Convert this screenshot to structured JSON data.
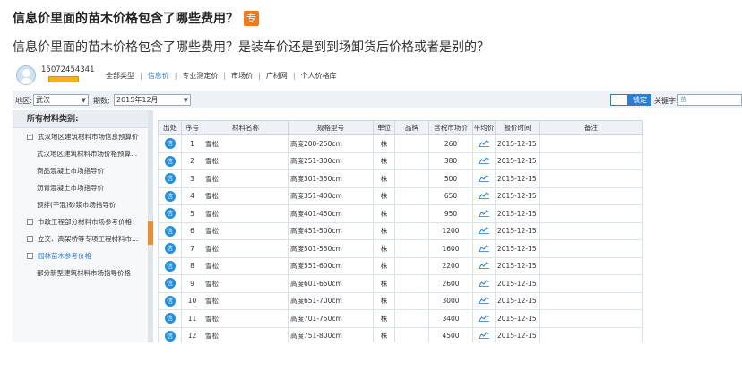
{
  "question": {
    "title": "信息价里面的苗木价格包含了哪些费用？",
    "badge": "专",
    "body": "信息价里面的苗木价格包含了哪些费用？是装车价还是到到场卸货后价格或者是别的？"
  },
  "app": {
    "user_id": "15072454341",
    "nav": [
      "全部类型",
      "信息价",
      "专业测定价",
      "市场价",
      "广材网",
      "个人价格库"
    ],
    "nav_active": "信息价",
    "filter": {
      "region_label": "地区:",
      "region_value": "武汉",
      "period_label": "期数:",
      "period_value": "2015年12月",
      "ok_label": "锁定",
      "keyword_label": "关键字:",
      "keyword_placeholder": "苗"
    },
    "sidebar": {
      "title": "所有材料类别:",
      "items": [
        {
          "label": "武汉地区建筑材料市场信息预算价",
          "has_toggle": true
        },
        {
          "label": "武汉地区建筑材料市场价格预算...",
          "has_toggle": false
        },
        {
          "label": "商品混凝土市场指导价",
          "has_toggle": false
        },
        {
          "label": "沥青混凝土市场指导价",
          "has_toggle": false
        },
        {
          "label": "预拌(干混)砂浆市场指导价",
          "has_toggle": false
        },
        {
          "label": "市政工程部分材料市场参考价格",
          "has_toggle": true
        },
        {
          "label": "立交、高架桥等专项工程材料市...",
          "has_toggle": true
        },
        {
          "label": "园林苗木参考价格",
          "has_toggle": true,
          "selected": true
        },
        {
          "label": "部分新型建筑材料市场指导价格",
          "has_toggle": false
        }
      ]
    },
    "table": {
      "headers": [
        "出处",
        "序号",
        "材料名称",
        "规格型号",
        "单位",
        "品牌",
        "含税市场价",
        "平均价",
        "报价时间",
        "备注"
      ],
      "source_badge": "信",
      "rows": [
        {
          "no": "1",
          "name": "雪松",
          "spec": "高度200-250cm",
          "unit": "株",
          "price": "260",
          "date": "2015-12-15"
        },
        {
          "no": "2",
          "name": "雪松",
          "spec": "高度251-300cm",
          "unit": "株",
          "price": "380",
          "date": "2015-12-15"
        },
        {
          "no": "3",
          "name": "雪松",
          "spec": "高度301-350cm",
          "unit": "株",
          "price": "500",
          "date": "2015-12-15"
        },
        {
          "no": "4",
          "name": "雪松",
          "spec": "高度351-400cm",
          "unit": "株",
          "price": "650",
          "date": "2015-12-15"
        },
        {
          "no": "5",
          "name": "雪松",
          "spec": "高度401-450cm",
          "unit": "株",
          "price": "950",
          "date": "2015-12-15"
        },
        {
          "no": "6",
          "name": "雪松",
          "spec": "高度451-500cm",
          "unit": "株",
          "price": "1200",
          "date": "2015-12-15"
        },
        {
          "no": "7",
          "name": "雪松",
          "spec": "高度501-550cm",
          "unit": "株",
          "price": "1600",
          "date": "2015-12-15"
        },
        {
          "no": "8",
          "name": "雪松",
          "spec": "高度551-600cm",
          "unit": "株",
          "price": "2200",
          "date": "2015-12-15"
        },
        {
          "no": "9",
          "name": "雪松",
          "spec": "高度601-650cm",
          "unit": "株",
          "price": "2600",
          "date": "2015-12-15"
        },
        {
          "no": "10",
          "name": "雪松",
          "spec": "高度651-700cm",
          "unit": "株",
          "price": "3000",
          "date": "2015-12-15"
        },
        {
          "no": "11",
          "name": "雪松",
          "spec": "高度701-750cm",
          "unit": "株",
          "price": "3400",
          "date": "2015-12-15"
        },
        {
          "no": "12",
          "name": "雪松",
          "spec": "高度751-800cm",
          "unit": "株",
          "price": "4500",
          "date": "2015-12-15"
        }
      ]
    }
  }
}
